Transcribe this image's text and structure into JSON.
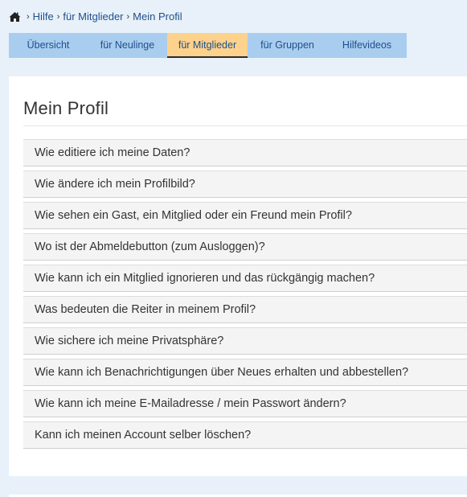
{
  "breadcrumb": {
    "home_icon": "home-icon",
    "separator": "›",
    "items": [
      "Hilfe",
      "für Mitglieder"
    ],
    "current": "Mein Profil"
  },
  "tabs": [
    {
      "label": "Übersicht",
      "active": false
    },
    {
      "label": "für Neulinge",
      "active": false
    },
    {
      "label": "für Mitglieder",
      "active": true
    },
    {
      "label": "für Gruppen",
      "active": false
    },
    {
      "label": "Hilfevideos",
      "active": false
    }
  ],
  "panel": {
    "title": "Mein Profil",
    "faq": [
      "Wie editiere ich meine Daten?",
      "Wie ändere ich mein Profilbild?",
      "Wie sehen ein Gast, ein Mitglied oder ein Freund mein Profil?",
      "Wo ist der Abmeldebutton (zum Ausloggen)?",
      "Wie kann ich ein Mitglied ignorieren und das rückgängig machen?",
      "Was bedeuten die Reiter in meinem Profil?",
      "Wie sichere ich meine Privatsphäre?",
      "Wie kann ich Benachrichtigungen über Neues erhalten und abbestellen?",
      "Wie kann ich meine E-Mailadresse / mein Passwort ändern?",
      "Kann ich meinen Account selber löschen?"
    ]
  },
  "colors": {
    "tab_bar": "#a8cdef",
    "tab_active": "#fcd28c",
    "link": "#1f4f8a",
    "page_bg": "#e8f1f9"
  }
}
